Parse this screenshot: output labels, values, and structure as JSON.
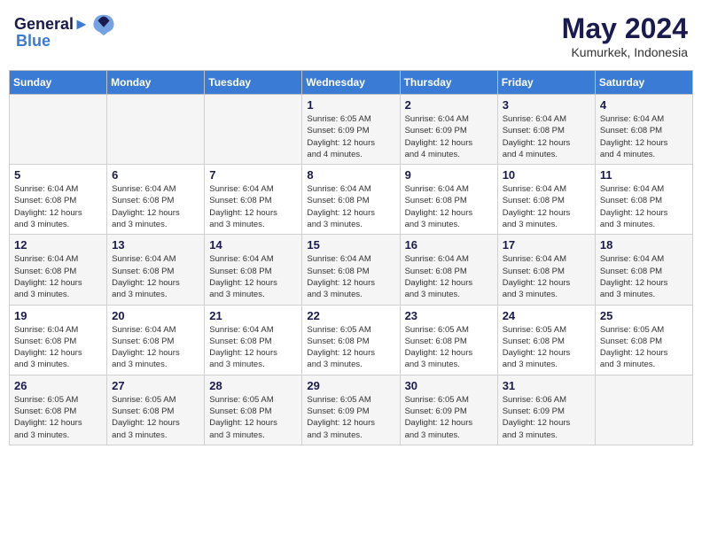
{
  "logo": {
    "line1": "General",
    "line2": "Blue"
  },
  "title": "May 2024",
  "subtitle": "Kumurkek, Indonesia",
  "days_header": [
    "Sunday",
    "Monday",
    "Tuesday",
    "Wednesday",
    "Thursday",
    "Friday",
    "Saturday"
  ],
  "weeks": [
    [
      {
        "num": "",
        "info": ""
      },
      {
        "num": "",
        "info": ""
      },
      {
        "num": "",
        "info": ""
      },
      {
        "num": "1",
        "info": "Sunrise: 6:05 AM\nSunset: 6:09 PM\nDaylight: 12 hours\nand 4 minutes."
      },
      {
        "num": "2",
        "info": "Sunrise: 6:04 AM\nSunset: 6:09 PM\nDaylight: 12 hours\nand 4 minutes."
      },
      {
        "num": "3",
        "info": "Sunrise: 6:04 AM\nSunset: 6:08 PM\nDaylight: 12 hours\nand 4 minutes."
      },
      {
        "num": "4",
        "info": "Sunrise: 6:04 AM\nSunset: 6:08 PM\nDaylight: 12 hours\nand 4 minutes."
      }
    ],
    [
      {
        "num": "5",
        "info": "Sunrise: 6:04 AM\nSunset: 6:08 PM\nDaylight: 12 hours\nand 3 minutes."
      },
      {
        "num": "6",
        "info": "Sunrise: 6:04 AM\nSunset: 6:08 PM\nDaylight: 12 hours\nand 3 minutes."
      },
      {
        "num": "7",
        "info": "Sunrise: 6:04 AM\nSunset: 6:08 PM\nDaylight: 12 hours\nand 3 minutes."
      },
      {
        "num": "8",
        "info": "Sunrise: 6:04 AM\nSunset: 6:08 PM\nDaylight: 12 hours\nand 3 minutes."
      },
      {
        "num": "9",
        "info": "Sunrise: 6:04 AM\nSunset: 6:08 PM\nDaylight: 12 hours\nand 3 minutes."
      },
      {
        "num": "10",
        "info": "Sunrise: 6:04 AM\nSunset: 6:08 PM\nDaylight: 12 hours\nand 3 minutes."
      },
      {
        "num": "11",
        "info": "Sunrise: 6:04 AM\nSunset: 6:08 PM\nDaylight: 12 hours\nand 3 minutes."
      }
    ],
    [
      {
        "num": "12",
        "info": "Sunrise: 6:04 AM\nSunset: 6:08 PM\nDaylight: 12 hours\nand 3 minutes."
      },
      {
        "num": "13",
        "info": "Sunrise: 6:04 AM\nSunset: 6:08 PM\nDaylight: 12 hours\nand 3 minutes."
      },
      {
        "num": "14",
        "info": "Sunrise: 6:04 AM\nSunset: 6:08 PM\nDaylight: 12 hours\nand 3 minutes."
      },
      {
        "num": "15",
        "info": "Sunrise: 6:04 AM\nSunset: 6:08 PM\nDaylight: 12 hours\nand 3 minutes."
      },
      {
        "num": "16",
        "info": "Sunrise: 6:04 AM\nSunset: 6:08 PM\nDaylight: 12 hours\nand 3 minutes."
      },
      {
        "num": "17",
        "info": "Sunrise: 6:04 AM\nSunset: 6:08 PM\nDaylight: 12 hours\nand 3 minutes."
      },
      {
        "num": "18",
        "info": "Sunrise: 6:04 AM\nSunset: 6:08 PM\nDaylight: 12 hours\nand 3 minutes."
      }
    ],
    [
      {
        "num": "19",
        "info": "Sunrise: 6:04 AM\nSunset: 6:08 PM\nDaylight: 12 hours\nand 3 minutes."
      },
      {
        "num": "20",
        "info": "Sunrise: 6:04 AM\nSunset: 6:08 PM\nDaylight: 12 hours\nand 3 minutes."
      },
      {
        "num": "21",
        "info": "Sunrise: 6:04 AM\nSunset: 6:08 PM\nDaylight: 12 hours\nand 3 minutes."
      },
      {
        "num": "22",
        "info": "Sunrise: 6:05 AM\nSunset: 6:08 PM\nDaylight: 12 hours\nand 3 minutes."
      },
      {
        "num": "23",
        "info": "Sunrise: 6:05 AM\nSunset: 6:08 PM\nDaylight: 12 hours\nand 3 minutes."
      },
      {
        "num": "24",
        "info": "Sunrise: 6:05 AM\nSunset: 6:08 PM\nDaylight: 12 hours\nand 3 minutes."
      },
      {
        "num": "25",
        "info": "Sunrise: 6:05 AM\nSunset: 6:08 PM\nDaylight: 12 hours\nand 3 minutes."
      }
    ],
    [
      {
        "num": "26",
        "info": "Sunrise: 6:05 AM\nSunset: 6:08 PM\nDaylight: 12 hours\nand 3 minutes."
      },
      {
        "num": "27",
        "info": "Sunrise: 6:05 AM\nSunset: 6:08 PM\nDaylight: 12 hours\nand 3 minutes."
      },
      {
        "num": "28",
        "info": "Sunrise: 6:05 AM\nSunset: 6:08 PM\nDaylight: 12 hours\nand 3 minutes."
      },
      {
        "num": "29",
        "info": "Sunrise: 6:05 AM\nSunset: 6:09 PM\nDaylight: 12 hours\nand 3 minutes."
      },
      {
        "num": "30",
        "info": "Sunrise: 6:05 AM\nSunset: 6:09 PM\nDaylight: 12 hours\nand 3 minutes."
      },
      {
        "num": "31",
        "info": "Sunrise: 6:06 AM\nSunset: 6:09 PM\nDaylight: 12 hours\nand 3 minutes."
      },
      {
        "num": "",
        "info": ""
      }
    ]
  ]
}
